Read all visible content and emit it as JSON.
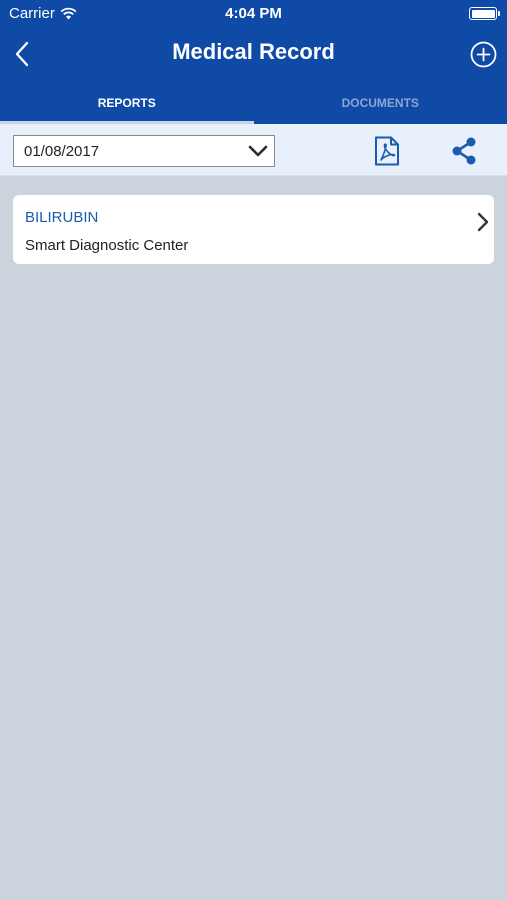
{
  "status_bar": {
    "carrier": "Carrier",
    "time": "4:04 PM"
  },
  "nav": {
    "title": "Medical Record"
  },
  "tabs": [
    {
      "label": "REPORTS",
      "active": true
    },
    {
      "label": "DOCUMENTS",
      "active": false
    }
  ],
  "toolbar": {
    "date_value": "01/08/2017"
  },
  "reports": [
    {
      "title": "BILIRUBIN",
      "center": "Smart Diagnostic Center"
    }
  ],
  "colors": {
    "header": "#0f4aa6",
    "toolbar": "#e8f1fb",
    "background": "#cbd3dc",
    "accent": "#1a5cb0"
  },
  "icons": [
    "wifi-icon",
    "battery-icon",
    "back-arrow-icon",
    "add-circle-icon",
    "chevron-down-icon",
    "pdf-icon",
    "share-icon",
    "chevron-right-icon"
  ]
}
